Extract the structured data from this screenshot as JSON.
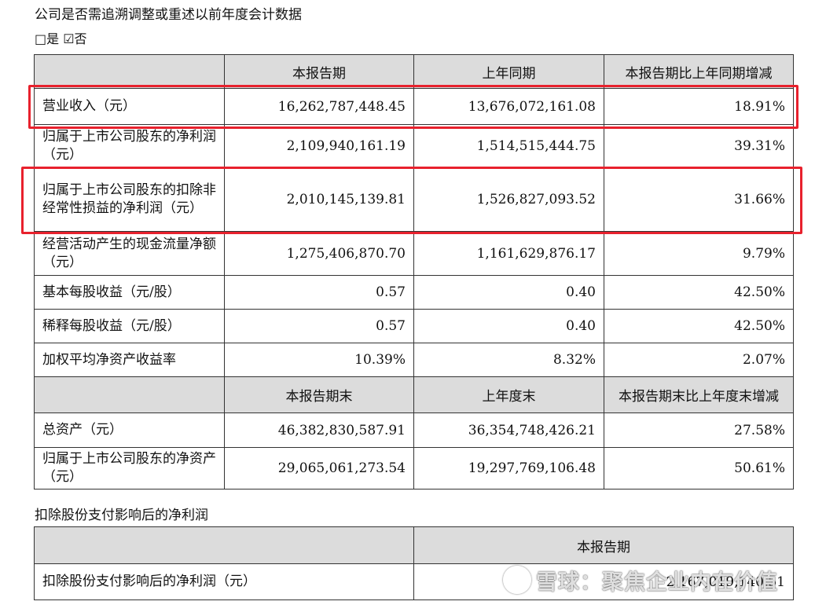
{
  "heading": "公司是否需追溯调整或重述以前年度会计数据",
  "checkbox_line": "□是 ☑否",
  "table1": {
    "header1": [
      "",
      "本报告期",
      "上年同期",
      "本报告期比上年同期增减"
    ],
    "rows1": [
      {
        "label": "营业收入（元）",
        "v1": "16,262,787,448.45",
        "v2": "13,676,072,161.08",
        "v3": "18.91%"
      },
      {
        "label": "归属于上市公司股东的净利润（元）",
        "v1": "2,109,940,161.19",
        "v2": "1,514,515,444.75",
        "v3": "39.31%"
      },
      {
        "label": "归属于上市公司股东的扣除非经常性损益的净利润（元）",
        "v1": "2,010,145,139.81",
        "v2": "1,526,827,093.52",
        "v3": "31.66%"
      },
      {
        "label": "经营活动产生的现金流量净额（元）",
        "v1": "1,275,406,870.70",
        "v2": "1,161,629,876.17",
        "v3": "9.79%"
      },
      {
        "label": "基本每股收益（元/股）",
        "v1": "0.57",
        "v2": "0.40",
        "v3": "42.50%"
      },
      {
        "label": "稀释每股收益（元/股）",
        "v1": "0.57",
        "v2": "0.40",
        "v3": "42.50%"
      },
      {
        "label": "加权平均净资产收益率",
        "v1": "10.39%",
        "v2": "8.32%",
        "v3": "2.07%"
      }
    ],
    "header2": [
      "",
      "本报告期末",
      "上年度末",
      "本报告期末比上年度末增减"
    ],
    "rows2": [
      {
        "label": "总资产（元）",
        "v1": "46,382,830,587.91",
        "v2": "36,354,748,426.21",
        "v3": "27.58%"
      },
      {
        "label": "归属于上市公司股东的净资产（元）",
        "v1": "29,065,061,273.54",
        "v2": "19,297,769,106.48",
        "v3": "50.61%"
      }
    ]
  },
  "section2_title": "扣除股份支付影响后的净利润",
  "table2": {
    "header": [
      "",
      "本报告期"
    ],
    "row": {
      "label": "扣除股份支付影响后的净利润（元）",
      "value": "2,167,019,140.51"
    }
  },
  "watermark": "雪球：聚焦企业内在价值",
  "colors": {
    "highlight": "#e8212d",
    "header_bg": "#dcdcdc",
    "border": "#333333"
  }
}
